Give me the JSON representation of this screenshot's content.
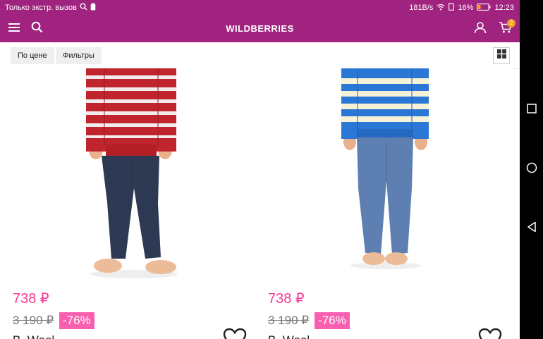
{
  "status_bar": {
    "carrier_text": "Только экстр. вызов",
    "network_speed": "181B/s",
    "battery_percent": "16%",
    "time": "12:23"
  },
  "app_bar": {
    "title": "WILDBERRIES",
    "cart_count": "2",
    "icons": [
      "menu-icon",
      "search-icon",
      "profile-icon",
      "cart-icon"
    ]
  },
  "filters": {
    "sort_label": "По цене",
    "filters_label": "Фильтры"
  },
  "products": [
    {
      "price": "738 ₽",
      "old_price": "3 190 ₽",
      "discount": "-76%",
      "brand": "B. Wool"
    },
    {
      "price": "738 ₽",
      "old_price": "3 190 ₽",
      "discount": "-76%",
      "brand": "B. Wool"
    }
  ],
  "colors": {
    "brand": "#a0237f",
    "price": "#f53b98",
    "discount_bg": "#f95fb0"
  }
}
